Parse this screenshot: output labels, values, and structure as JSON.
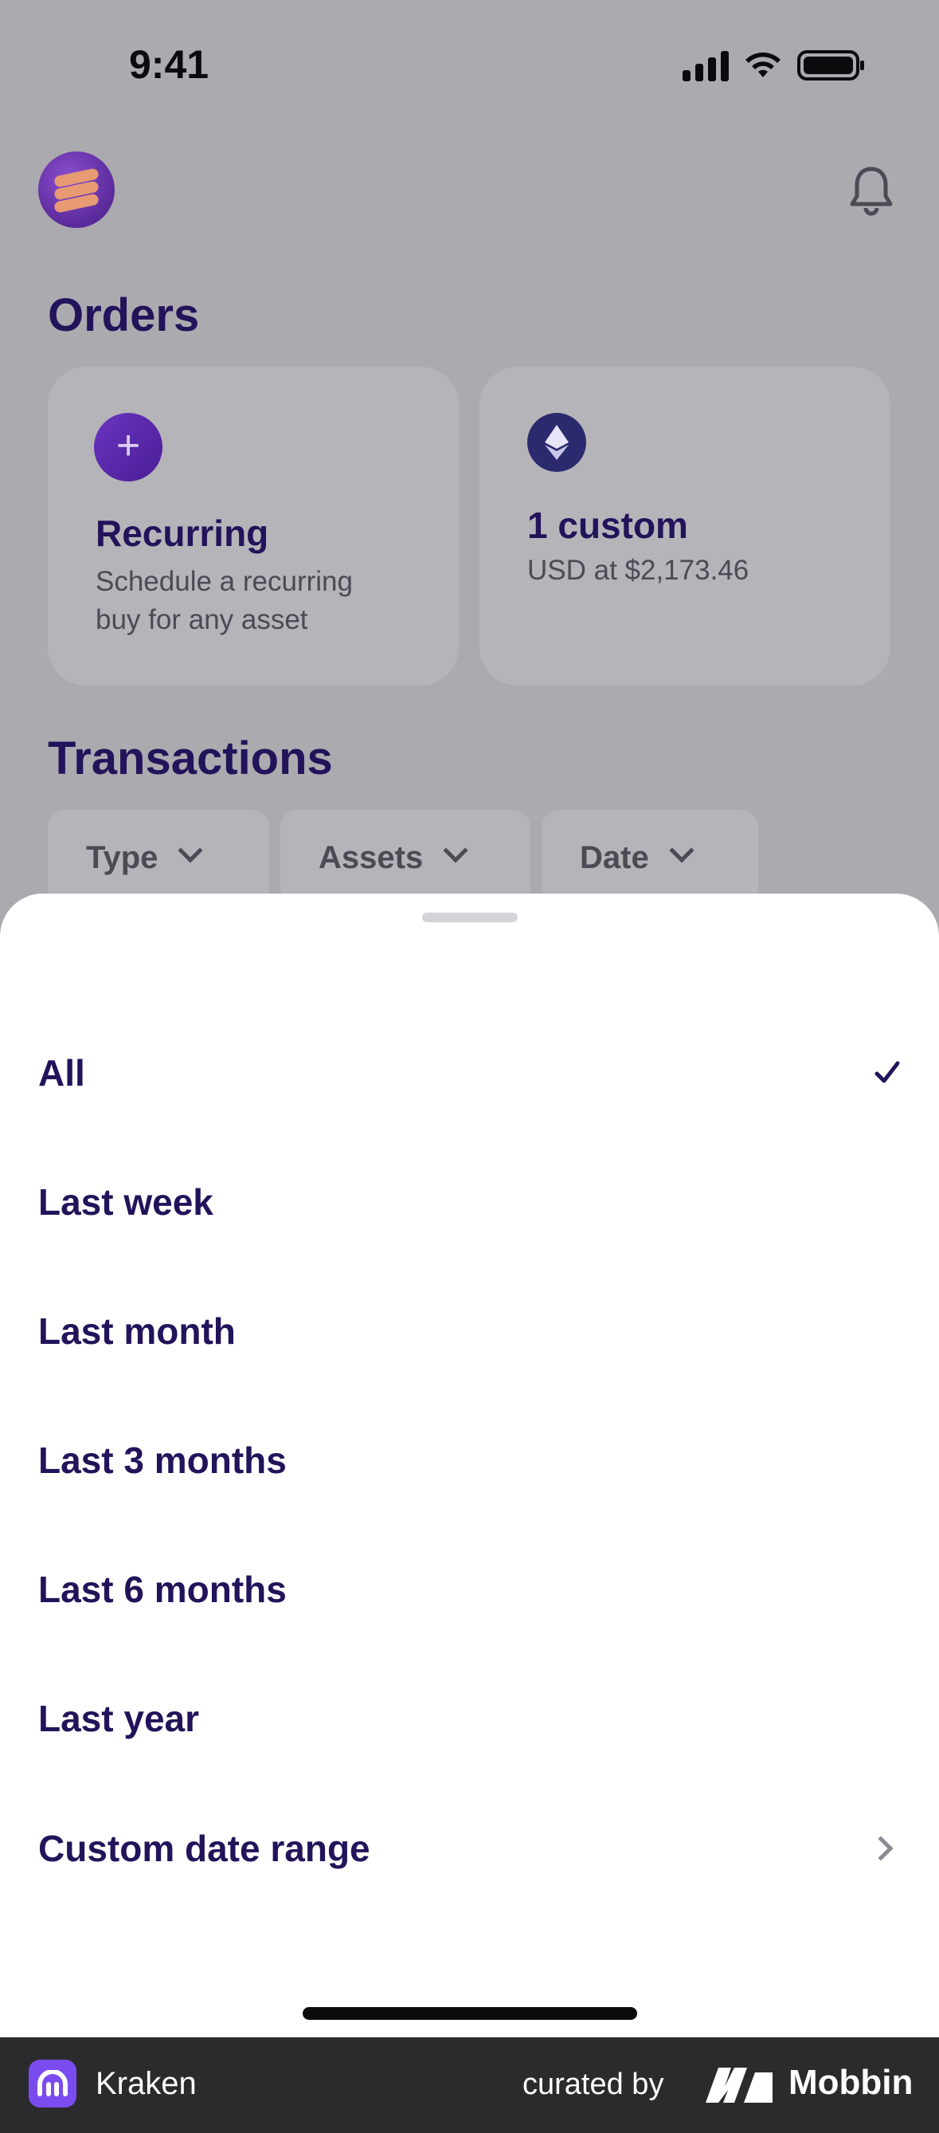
{
  "status_bar": {
    "time": "9:41"
  },
  "header": {
    "avatar": "avatar-stack-icon",
    "bell": "bell-icon"
  },
  "orders": {
    "title": "Orders",
    "cards": [
      {
        "icon": "plus-icon",
        "title": "Recurring",
        "subtitle_line1": "Schedule a recurring",
        "subtitle_line2": "buy for any asset"
      },
      {
        "icon": "ethereum-icon",
        "title": "1 custom",
        "subtitle_line1": "USD at $2,173.46"
      }
    ]
  },
  "transactions": {
    "title": "Transactions",
    "filters": [
      {
        "label": "Type"
      },
      {
        "label": "Assets"
      },
      {
        "label": "Date"
      }
    ]
  },
  "date_sheet": {
    "options": [
      {
        "label": "All",
        "selected": true
      },
      {
        "label": "Last week"
      },
      {
        "label": "Last month"
      },
      {
        "label": "Last 3 months"
      },
      {
        "label": "Last 6 months"
      },
      {
        "label": "Last year"
      },
      {
        "label": "Custom date range",
        "has_chevron": true
      }
    ]
  },
  "footer": {
    "app_name": "Kraken",
    "curated_by": "curated by",
    "brand": "Mobbin"
  },
  "colors": {
    "accent": "#23135a",
    "brand_purple": "#5a2a9a",
    "overlay": "#abaaaf"
  }
}
